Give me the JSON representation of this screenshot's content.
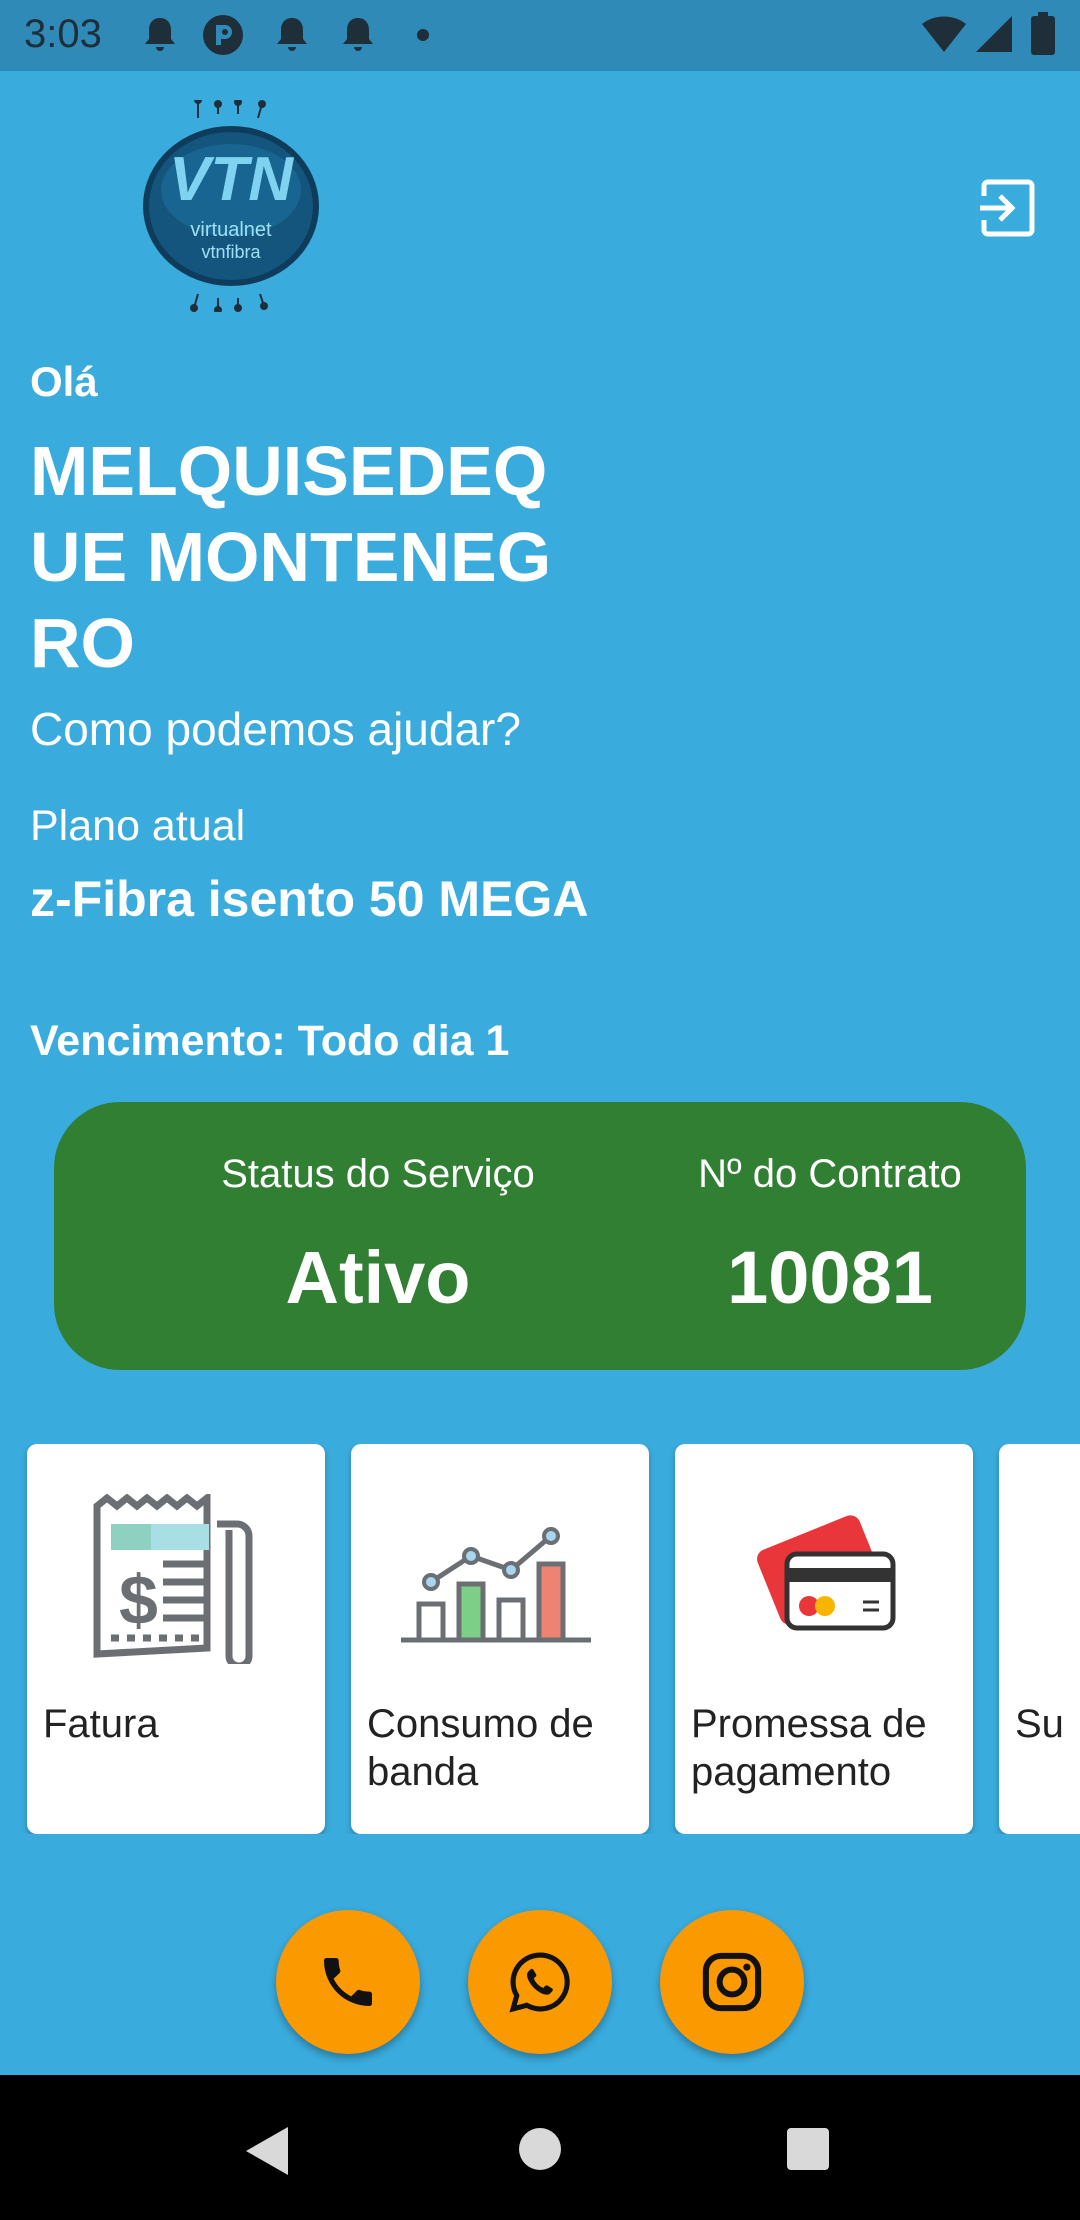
{
  "status_bar": {
    "time": "3:03",
    "icons": [
      "notification-bell-icon",
      "app-notification-icon",
      "notification-bell-icon",
      "notification-bell-icon",
      "dot-icon",
      "wifi-icon",
      "cell-signal-icon",
      "battery-icon"
    ]
  },
  "header": {
    "logo_line1": "virtualnet",
    "logo_line2": "vtnfibra",
    "logout_icon": "logout-icon"
  },
  "greeting": "Olá",
  "user_name": "MELQUISEDEQUE MONTENEGRO",
  "help_text": "Como podemos ajudar?",
  "plan": {
    "label": "Plano atual",
    "name": "z-Fibra isento 50 MEGA"
  },
  "due": {
    "label": "Vencimento:",
    "value": "Todo dia 1"
  },
  "service": {
    "status_label": "Status do Serviço",
    "status_value": "Ativo",
    "contract_label": "Nº do Contrato",
    "contract_value": "10081"
  },
  "menu_cards": [
    {
      "label": "Fatura",
      "icon": "invoice-icon"
    },
    {
      "label": "Consumo de banda",
      "icon": "bandwidth-chart-icon"
    },
    {
      "label": "Promessa de pagamento",
      "icon": "credit-card-icon"
    },
    {
      "label": "Su",
      "icon": "support-icon"
    }
  ],
  "contact_buttons": [
    {
      "icon": "phone-icon"
    },
    {
      "icon": "whatsapp-icon"
    },
    {
      "icon": "instagram-icon"
    }
  ],
  "colors": {
    "background": "#3aabdd",
    "status_bar": "#2f8ab7",
    "status_card": "#317f33",
    "fab": "#fb9900"
  }
}
